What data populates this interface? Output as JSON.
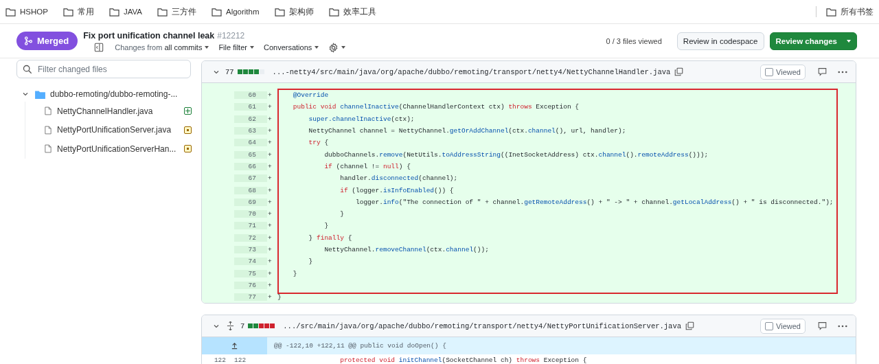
{
  "bookmarks": {
    "items": [
      "HSHOP",
      "常用",
      "JAVA",
      "三方件",
      "Algorithm",
      "架构师",
      "效率工具"
    ],
    "all": "所有书签"
  },
  "pr": {
    "state": "Merged",
    "title": "Fix port unification channel leak",
    "number": "#12212",
    "toolbar": {
      "changes_prefix": "Changes from",
      "changes_value": "all commits",
      "file_filter": "File filter",
      "conversations": "Conversations"
    },
    "files_viewed": "0 / 3 files viewed",
    "codespace_button": "Review in codespace",
    "review_button": "Review changes"
  },
  "sidebar": {
    "search": {
      "placeholder": "Filter changed files"
    },
    "tree": [
      {
        "name": "dubbo-remoting/dubbo-remoting-...",
        "expanded": true,
        "children": [
          {
            "name": "NettyChannelHandler.java",
            "kind": "added"
          },
          {
            "name": "NettyPortUnificationServer.java",
            "kind": "modified"
          },
          {
            "name": "NettyPortUnificationServerHan...",
            "kind": "modified"
          }
        ]
      }
    ]
  },
  "files": [
    {
      "count": "77",
      "stats": [
        {
          "kind": "added"
        },
        {
          "kind": "added"
        },
        {
          "kind": "added"
        },
        {
          "kind": "added"
        },
        {
          "kind": "neutral"
        }
      ],
      "path": "...-netty4/src/main/java/org/apache/dubbo/remoting/transport/netty4/NettyChannelHandler.java",
      "viewed_label": "Viewed",
      "viewed": false,
      "expand_control": false,
      "blocks": [
        {
          "highlighted": true,
          "lines": [
            {
              "new": "60",
              "kind": "added",
              "marker": "+",
              "tokens": [
                {
                  "text": "    @Override",
                  "kind": "call"
                }
              ]
            },
            {
              "new": "61",
              "kind": "added",
              "marker": "+",
              "tokens": [
                {
                  "text": "    public void ",
                  "kind": "keyword"
                },
                {
                  "text": "channelInactive",
                  "kind": "call"
                },
                {
                  "text": "(ChannelHandlerContext ctx) ",
                  "kind": "plain"
                },
                {
                  "text": "throws",
                  "kind": "keyword"
                },
                {
                  "text": " Exception {",
                  "kind": "plain"
                }
              ]
            },
            {
              "new": "62",
              "kind": "added",
              "marker": "+",
              "tokens": [
                {
                  "text": "        super.channelInactive",
                  "kind": "call"
                },
                {
                  "text": "(ctx);",
                  "kind": "plain"
                }
              ]
            },
            {
              "new": "63",
              "kind": "added",
              "marker": "+",
              "tokens": [
                {
                  "text": "        NettyChannel channel = NettyChannel.",
                  "kind": "plain"
                },
                {
                  "text": "getOrAddChannel",
                  "kind": "call"
                },
                {
                  "text": "(ctx.",
                  "kind": "plain"
                },
                {
                  "text": "channel",
                  "kind": "call"
                },
                {
                  "text": "(), url, handler);",
                  "kind": "plain"
                }
              ]
            },
            {
              "new": "64",
              "kind": "added",
              "marker": "+",
              "tokens": [
                {
                  "text": "        try",
                  "kind": "keyword"
                },
                {
                  "text": " {",
                  "kind": "plain"
                }
              ]
            },
            {
              "new": "65",
              "kind": "added",
              "marker": "+",
              "tokens": [
                {
                  "text": "            dubboChannels.",
                  "kind": "plain"
                },
                {
                  "text": "remove",
                  "kind": "call"
                },
                {
                  "text": "(NetUtils.",
                  "kind": "plain"
                },
                {
                  "text": "toAddressString",
                  "kind": "call"
                },
                {
                  "text": "((InetSocketAddress) ctx.",
                  "kind": "plain"
                },
                {
                  "text": "channel",
                  "kind": "call"
                },
                {
                  "text": "().",
                  "kind": "plain"
                },
                {
                  "text": "remoteAddress",
                  "kind": "call"
                },
                {
                  "text": "()));",
                  "kind": "plain"
                }
              ]
            },
            {
              "new": "66",
              "kind": "added",
              "marker": "+",
              "tokens": [
                {
                  "text": "            if",
                  "kind": "keyword"
                },
                {
                  "text": " (channel != ",
                  "kind": "plain"
                },
                {
                  "text": "null",
                  "kind": "keyword"
                },
                {
                  "text": ") {",
                  "kind": "plain"
                }
              ]
            },
            {
              "new": "67",
              "kind": "added",
              "marker": "+",
              "tokens": [
                {
                  "text": "                handler.",
                  "kind": "plain"
                },
                {
                  "text": "disconnected",
                  "kind": "call"
                },
                {
                  "text": "(channel);",
                  "kind": "plain"
                }
              ]
            },
            {
              "new": "68",
              "kind": "added",
              "marker": "+",
              "tokens": [
                {
                  "text": "                if",
                  "kind": "keyword"
                },
                {
                  "text": " (logger.",
                  "kind": "plain"
                },
                {
                  "text": "isInfoEnabled",
                  "kind": "call"
                },
                {
                  "text": "()) {",
                  "kind": "plain"
                }
              ]
            },
            {
              "new": "69",
              "kind": "added",
              "marker": "+",
              "tokens": [
                {
                  "text": "                    logger.",
                  "kind": "plain"
                },
                {
                  "text": "info",
                  "kind": "call"
                },
                {
                  "text": "(\"The connection of \" + channel.",
                  "kind": "plain"
                },
                {
                  "text": "getRemoteAddress",
                  "kind": "call"
                },
                {
                  "text": "() + \" -> \" + channel.",
                  "kind": "plain"
                },
                {
                  "text": "getLocalAddress",
                  "kind": "call"
                },
                {
                  "text": "() + \" is disconnected.\");",
                  "kind": "plain"
                }
              ]
            },
            {
              "new": "70",
              "kind": "added",
              "marker": "+",
              "tokens": [
                {
                  "text": "                }",
                  "kind": "plain"
                }
              ]
            },
            {
              "new": "71",
              "kind": "added",
              "marker": "+",
              "tokens": [
                {
                  "text": "            }",
                  "kind": "plain"
                }
              ]
            },
            {
              "new": "72",
              "kind": "added",
              "marker": "+",
              "tokens": [
                {
                  "text": "        } ",
                  "kind": "plain"
                },
                {
                  "text": "finally",
                  "kind": "keyword"
                },
                {
                  "text": " {",
                  "kind": "plain"
                }
              ]
            },
            {
              "new": "73",
              "kind": "added",
              "marker": "+",
              "tokens": [
                {
                  "text": "            NettyChannel.",
                  "kind": "plain"
                },
                {
                  "text": "removeChannel",
                  "kind": "call"
                },
                {
                  "text": "(ctx.",
                  "kind": "plain"
                },
                {
                  "text": "channel",
                  "kind": "call"
                },
                {
                  "text": "());",
                  "kind": "plain"
                }
              ]
            },
            {
              "new": "74",
              "kind": "added",
              "marker": "+",
              "tokens": [
                {
                  "text": "        }",
                  "kind": "plain"
                }
              ]
            },
            {
              "new": "75",
              "kind": "added",
              "marker": "+",
              "tokens": [
                {
                  "text": "    }",
                  "kind": "plain"
                }
              ]
            },
            {
              "new": "76",
              "kind": "added",
              "marker": "+"
            }
          ]
        },
        {
          "highlighted": false,
          "lines": [
            {
              "new": "77",
              "kind": "added",
              "marker": "+",
              "tokens": [
                {
                  "text": "}",
                  "kind": "plain"
                }
              ]
            }
          ]
        }
      ]
    },
    {
      "count": "7",
      "stats": [
        {
          "kind": "added"
        },
        {
          "kind": "added"
        },
        {
          "kind": "deleted"
        },
        {
          "kind": "deleted"
        },
        {
          "kind": "deleted"
        }
      ],
      "path": ".../src/main/java/org/apache/dubbo/remoting/transport/netty4/NettyPortUnificationServer.java",
      "viewed_label": "Viewed",
      "viewed": false,
      "expand_control": true,
      "hunk": "@@ -122,10 +122,11 @@ public void doOpen() {",
      "blocks": [
        {
          "highlighted": false,
          "lines": [
            {
              "old": "122",
              "new": "122",
              "kind": "context",
              "tokens": [
                {
                  "text": "                protected void ",
                  "kind": "keyword"
                },
                {
                  "text": "initChannel",
                  "kind": "call"
                },
                {
                  "text": "(SocketChannel ch) ",
                  "kind": "plain"
                },
                {
                  "text": "throws",
                  "kind": "keyword"
                },
                {
                  "text": " Exception {",
                  "kind": "plain"
                }
              ]
            }
          ]
        }
      ]
    }
  ]
}
